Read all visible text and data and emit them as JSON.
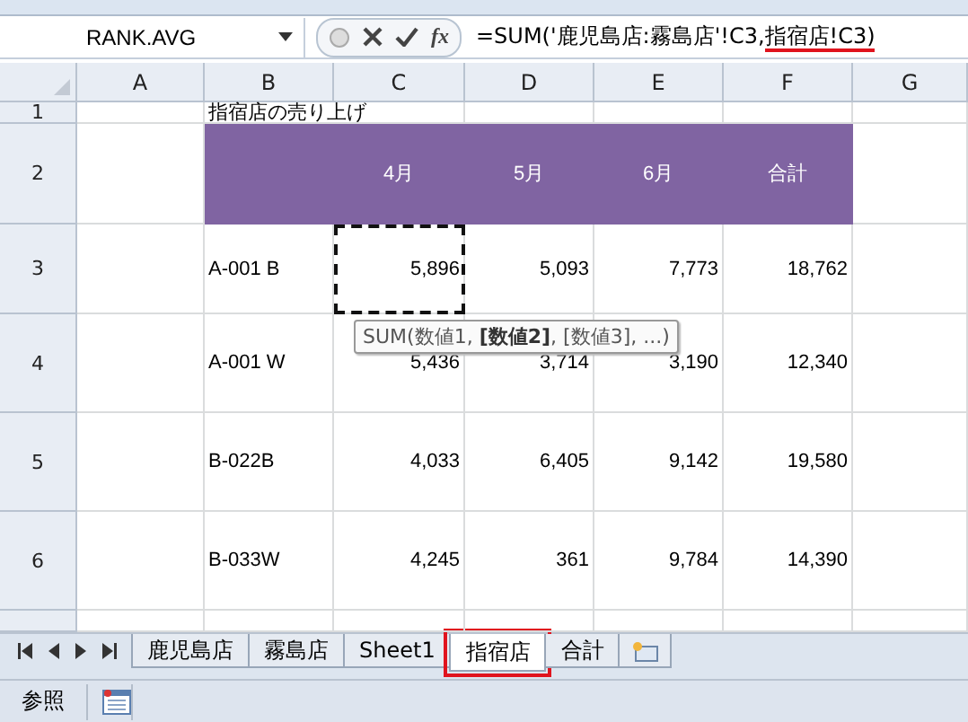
{
  "formula_bar": {
    "name_box": "RANK.AVG",
    "function_button": "fx",
    "formula": [
      {
        "text": "=SUM('鹿児島店:霧島店'!C3,",
        "underlined": false
      },
      {
        "text": "指宿店!C3)",
        "underlined": true
      }
    ]
  },
  "sheet": {
    "columns": [
      "A",
      "B",
      "C",
      "D",
      "E",
      "F",
      "G"
    ],
    "rows": [
      {
        "number": "1",
        "kind": "title",
        "cells": [
          {
            "marquee": false
          },
          {
            "text": "指宿店の売り上げ",
            "marquee": false
          },
          {
            "marquee": false
          },
          {
            "marquee": false
          },
          {
            "marquee": false
          },
          {
            "marquee": false
          },
          {
            "marquee": false
          }
        ]
      },
      {
        "number": "2",
        "kind": "header",
        "cells": [
          {
            "marquee": false
          },
          {
            "marquee": false
          },
          {
            "text": "4月",
            "marquee": false
          },
          {
            "text": "5月",
            "marquee": false
          },
          {
            "text": "6月",
            "marquee": false
          },
          {
            "text": "合計",
            "marquee": false
          },
          {
            "marquee": false
          }
        ]
      },
      {
        "number": "3",
        "kind": "data",
        "cells": [
          {
            "marquee": false
          },
          {
            "text": "A-001 B",
            "marquee": false
          },
          {
            "text": "5,896",
            "marquee": true
          },
          {
            "text": "5,093",
            "marquee": false
          },
          {
            "text": "7,773",
            "marquee": false
          },
          {
            "text": "18,762",
            "marquee": false
          },
          {
            "marquee": false
          }
        ]
      },
      {
        "number": "4",
        "kind": "data",
        "cells": [
          {
            "marquee": false
          },
          {
            "text": "A-001 W",
            "marquee": false
          },
          {
            "text": "5,436",
            "marquee": false
          },
          {
            "text": "3,714",
            "marquee": false
          },
          {
            "text": "3,190",
            "marquee": false
          },
          {
            "text": "12,340",
            "marquee": false
          },
          {
            "marquee": false
          }
        ]
      },
      {
        "number": "5",
        "kind": "data",
        "cells": [
          {
            "marquee": false
          },
          {
            "text": "B-022B",
            "marquee": false
          },
          {
            "text": "4,033",
            "marquee": false
          },
          {
            "text": "6,405",
            "marquee": false
          },
          {
            "text": "9,142",
            "marquee": false
          },
          {
            "text": "19,580",
            "marquee": false
          },
          {
            "marquee": false
          }
        ]
      },
      {
        "number": "6",
        "kind": "data",
        "cells": [
          {
            "marquee": false
          },
          {
            "text": "B-033W",
            "marquee": false
          },
          {
            "text": "4,245",
            "marquee": false
          },
          {
            "text": "361",
            "marquee": false
          },
          {
            "text": "9,784",
            "marquee": false
          },
          {
            "text": "14,390",
            "marquee": false
          },
          {
            "marquee": false
          }
        ]
      }
    ]
  },
  "tooltip": {
    "text": "SUM(数値1, **[数値2]**, [数値3], ...)"
  },
  "sheet_tabs": [
    {
      "label": "鹿児島店",
      "selected": false,
      "highlighted": false
    },
    {
      "label": "霧島店",
      "selected": false,
      "highlighted": false
    },
    {
      "label": "Sheet1",
      "selected": false,
      "highlighted": false
    },
    {
      "label": "指宿店",
      "selected": true,
      "highlighted": true
    },
    {
      "label": "合計",
      "selected": false,
      "highlighted": false
    }
  ],
  "status_bar": {
    "mode": "参照"
  }
}
